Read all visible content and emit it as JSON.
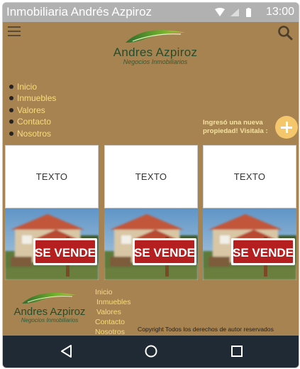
{
  "status_bar": {
    "app_title": "Inmobiliaria Andrés Azpiroz",
    "time": "13:00",
    "icons": [
      "wifi-icon",
      "signal-icon",
      "battery-icon"
    ]
  },
  "header": {
    "menu_icon": "hamburger-menu-icon",
    "search_icon": "search-icon",
    "logo": {
      "brand": "Andres Azpiroz",
      "tagline": "Negocios Inmobiliarios"
    }
  },
  "nav": {
    "items": [
      "Inicio",
      "Inmuebles",
      "Valores",
      "Contacto",
      "Nosotros"
    ]
  },
  "promo": {
    "text": "Ingresó una nueva propiedad! Visitala :",
    "button_icon": "plus-icon"
  },
  "cards": [
    {
      "text": "TEXTO",
      "sign": "SE VENDE"
    },
    {
      "text": "TEXTO",
      "sign": "SE VENDE"
    },
    {
      "text": "TEXTO",
      "sign": "SE VENDE"
    }
  ],
  "footer": {
    "logo": {
      "brand": "Andres Azpiroz",
      "tagline": "Negocios Inmobiliarios"
    },
    "nav": [
      "Inicio",
      "Inmuebles",
      "Valores",
      "Contacto",
      "Nosotros"
    ],
    "copyright": "Copyright Todos los derechos de autor reservados"
  },
  "android_nav": [
    "back-icon",
    "home-icon",
    "recents-icon"
  ],
  "colors": {
    "background": "#a88352",
    "status_bar": "#b1b1b1",
    "nav_text": "#f7dd7b",
    "accent_button": "#f5c76c",
    "logo_green": "#244d2d",
    "sign_red": "#b51f1f",
    "navbar": "#1f2a35"
  }
}
